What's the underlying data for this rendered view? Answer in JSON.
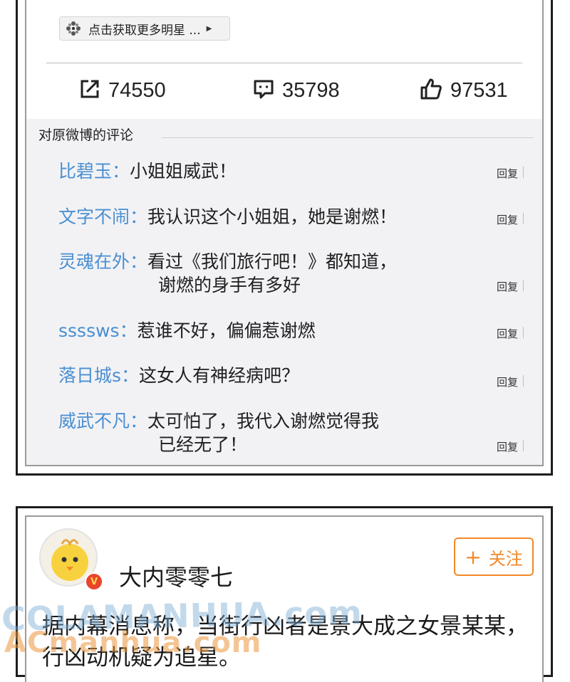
{
  "top_card": {
    "more_stars_button": {
      "label": "点击获取更多明星 ...",
      "icon": "flower-icon"
    },
    "stats": {
      "forward": {
        "icon": "share-icon",
        "count": "74550"
      },
      "comment": {
        "icon": "comment-icon",
        "count": "35798"
      },
      "like": {
        "icon": "thumbs-up-icon",
        "count": "97531"
      }
    },
    "comments_title": "对原微博的评论",
    "reply_label": "回复",
    "comments": [
      {
        "user": "比碧玉：",
        "text": "小姐姐威武！",
        "cont": ""
      },
      {
        "user": "文字不闹：",
        "text": "我认识这个小姐姐，她是谢燃！",
        "cont": ""
      },
      {
        "user": "灵魂在外：",
        "text": "看过《我们旅行吧！》都知道，",
        "cont": "谢燃的身手有多好"
      },
      {
        "user": "ssssws：",
        "text": "惹谁不好，偏偏惹谢燃",
        "cont": ""
      },
      {
        "user": "落日城s：",
        "text": "这女人有神经病吧？",
        "cont": ""
      },
      {
        "user": "威武不凡：",
        "text": "太可怕了，我代入谢燃觉得我",
        "cont": "已经无了！"
      }
    ]
  },
  "bottom_card": {
    "profile_name": "大内零零七",
    "verified_badge": "V",
    "follow_button": {
      "icon": "plus-icon",
      "plus": "+",
      "label": "关注"
    },
    "post_lines": [
      "据内幕消息称，当街行凶者是景大成之女景某某，",
      "行凶动机疑为追星。"
    ]
  },
  "watermark": {
    "line1": "COLAMANHUA.com",
    "line2": "ACmanhua.com"
  },
  "colors": {
    "username_blue": "#4a8fd1",
    "follow_orange": "#f1892a",
    "verified_red": "#e8452c"
  }
}
